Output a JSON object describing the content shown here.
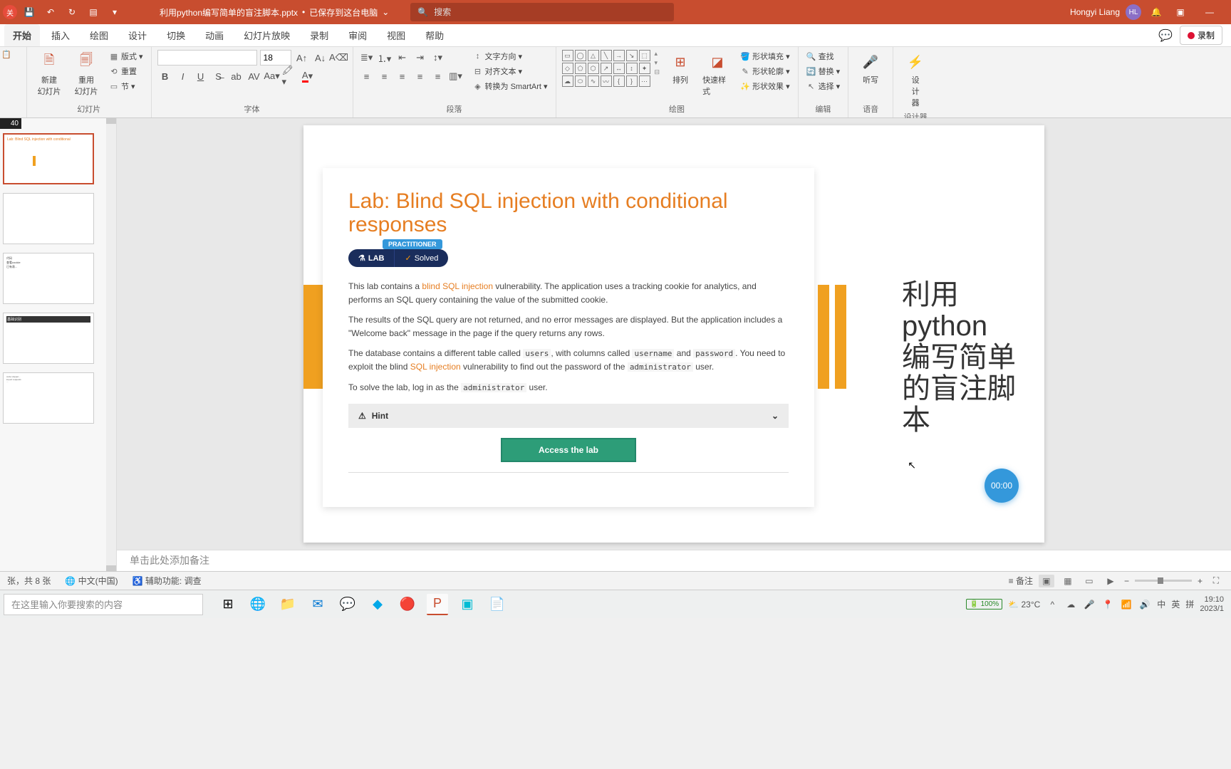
{
  "titlebar": {
    "doc_name": "利用python编写简单的盲注脚本.pptx",
    "saved_status": "已保存到这台电脑",
    "search_placeholder": "搜索",
    "user_name": "Hongyi Liang",
    "user_initials": "HL"
  },
  "ribbon_tabs": [
    "开始",
    "插入",
    "绘图",
    "设计",
    "切换",
    "动画",
    "幻灯片放映",
    "录制",
    "审阅",
    "视图",
    "帮助"
  ],
  "record_label": "录制",
  "ribbon": {
    "slides": {
      "new": "新建\n幻灯片",
      "reuse": "重用\n幻灯片",
      "layout": "版式",
      "reset": "重置",
      "section": "节",
      "label": "幻灯片"
    },
    "font": {
      "size": "18",
      "label": "字体"
    },
    "para": {
      "dir": "文字方向",
      "align": "对齐文本",
      "smart": "转换为 SmartArt",
      "label": "段落"
    },
    "draw": {
      "arrange": "排列",
      "quick": "快速样式",
      "fill": "形状填充",
      "outline": "形状轮廓",
      "effect": "形状效果",
      "label": "绘图"
    },
    "edit": {
      "find": "查找",
      "replace": "替换",
      "select": "选择",
      "label": "编辑"
    },
    "voice": {
      "dictate": "听写",
      "label": "语音"
    },
    "designer": {
      "btn": "设\n计\n器",
      "label": "设计器"
    }
  },
  "slide_top_num": "40",
  "slide_content": {
    "title": "Lab: Blind SQL injection with conditional responses",
    "practitioner": "PRACTITIONER",
    "lab_badge": "LAB",
    "solved": "Solved",
    "para1_a": "This lab contains a ",
    "para1_link": "blind SQL injection",
    "para1_b": " vulnerability. The application uses a tracking cookie for analytics, and performs an SQL query containing the value of the submitted cookie.",
    "para2": "The results of the SQL query are not returned, and no error messages are displayed. But the application includes a \"Welcome back\" message in the page if the query returns any rows.",
    "para3_a": "The database contains a different table called ",
    "para3_users": "users",
    "para3_b": ", with columns called ",
    "para3_un": "username",
    "para3_c": " and ",
    "para3_pw": "password",
    "para3_d": ". You need to exploit the blind ",
    "para3_link": "SQL injection",
    "para3_e": " vulnerability to find out the password of the ",
    "para3_admin": "administrator",
    "para3_f": " user.",
    "para4_a": "To solve the lab, log in as the ",
    "para4_admin": "administrator",
    "para4_b": " user.",
    "hint": "Hint",
    "access": "Access the lab",
    "cn_title": "利用python编写简单的盲注脚本",
    "timer": "00:00"
  },
  "notes_placeholder": "单击此处添加备注",
  "status": {
    "slide_info": "张，共 8 张",
    "lang": "中文(中国)",
    "access": "辅助功能: 调查",
    "notes_btn": "备注"
  },
  "taskbar": {
    "search": "在这里输入你要搜索的内容",
    "temp": "23°C",
    "battery": "100%",
    "ime1": "中",
    "ime2": "英",
    "ime3": "拼",
    "time": "19:10",
    "date": "2023/1"
  }
}
